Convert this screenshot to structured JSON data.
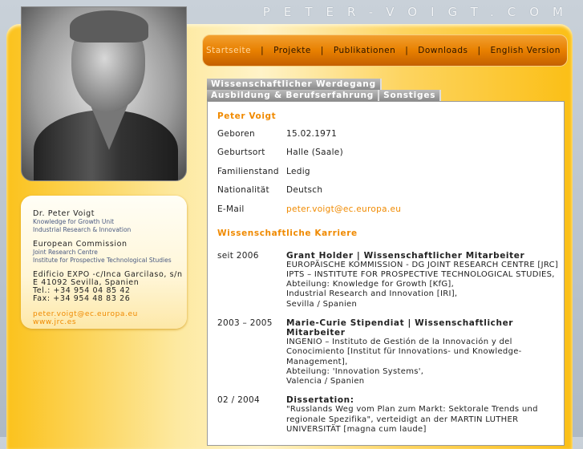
{
  "site_title": "PETER-VOIGT.COM",
  "nav": [
    {
      "label": "Startseite",
      "active": true
    },
    {
      "label": "Projekte"
    },
    {
      "label": "Publikationen"
    },
    {
      "label": "Downloads"
    },
    {
      "label": "English Version"
    }
  ],
  "nav_separator": "|",
  "tabs": [
    "Wissenschaftlicher Werdegang",
    "Ausbildung & Berufserfahrung",
    "Sonstiges"
  ],
  "card": {
    "name": "Dr. Peter Voigt",
    "unit": "Knowledge for Growth Unit",
    "dept": "Industrial Research & Innovation",
    "org": "European Commission",
    "org_sub1": "Joint Research Centre",
    "org_sub2": "Institute for Prospective Technological Studies",
    "addr1": "Edificio EXPO -c/Inca Garcilaso, s/n",
    "addr2": "E 41092 Sevilla, Spanien",
    "tel": "Tel.: +34 954 04 85 42",
    "fax": "Fax: +34 954 48 83 26",
    "email": "peter.voigt@ec.europa.eu",
    "web": "www.jrc.es"
  },
  "profile": {
    "heading": "Peter Voigt",
    "rows": [
      {
        "k": "Geboren",
        "v": "15.02.1971"
      },
      {
        "k": "Geburtsort",
        "v": "Halle (Saale)"
      },
      {
        "k": "Familienstand",
        "v": "Ledig"
      },
      {
        "k": "Nationalität",
        "v": "Deutsch"
      },
      {
        "k": "E-Mail",
        "v": "peter.voigt@ec.europa.eu"
      }
    ]
  },
  "career": {
    "heading": "Wissenschaftliche Karriere",
    "entries": [
      {
        "date": "seit 2006",
        "title": "Grant Holder | Wissenschaftlicher Mitarbeiter",
        "lines": [
          "EUROPÄISCHE KOMMISSION - DG JOINT RESEARCH CENTRE [JRC]",
          "IPTS – INSTITUTE FOR PROSPECTIVE TECHNOLOGICAL STUDIES,",
          "Abteilung: Knowledge for Growth [KfG],",
          "Industrial Research and Innovation [IRI],",
          "Sevilla / Spanien"
        ]
      },
      {
        "date": "2003 – 2005",
        "title": "Marie-Curie Stipendiat | Wissenschaftlicher Mitarbeiter",
        "lines": [
          "INGENIO – Instituto de Gestión de la Innovación y del Conocimiento [Institut für Innovations- und Knowledge-Management],",
          "Abteilung: 'Innovation Systems',",
          "Valencia / Spanien"
        ]
      },
      {
        "date": "02 / 2004",
        "title": "Dissertation:",
        "lines": [
          "\"Russlands Weg vom Plan zum Markt: Sektorale Trends und regionale Spezifika\", verteidigt an der MARTIN LUTHER UNIVERSITÄT [magna cum laude]"
        ]
      }
    ]
  }
}
